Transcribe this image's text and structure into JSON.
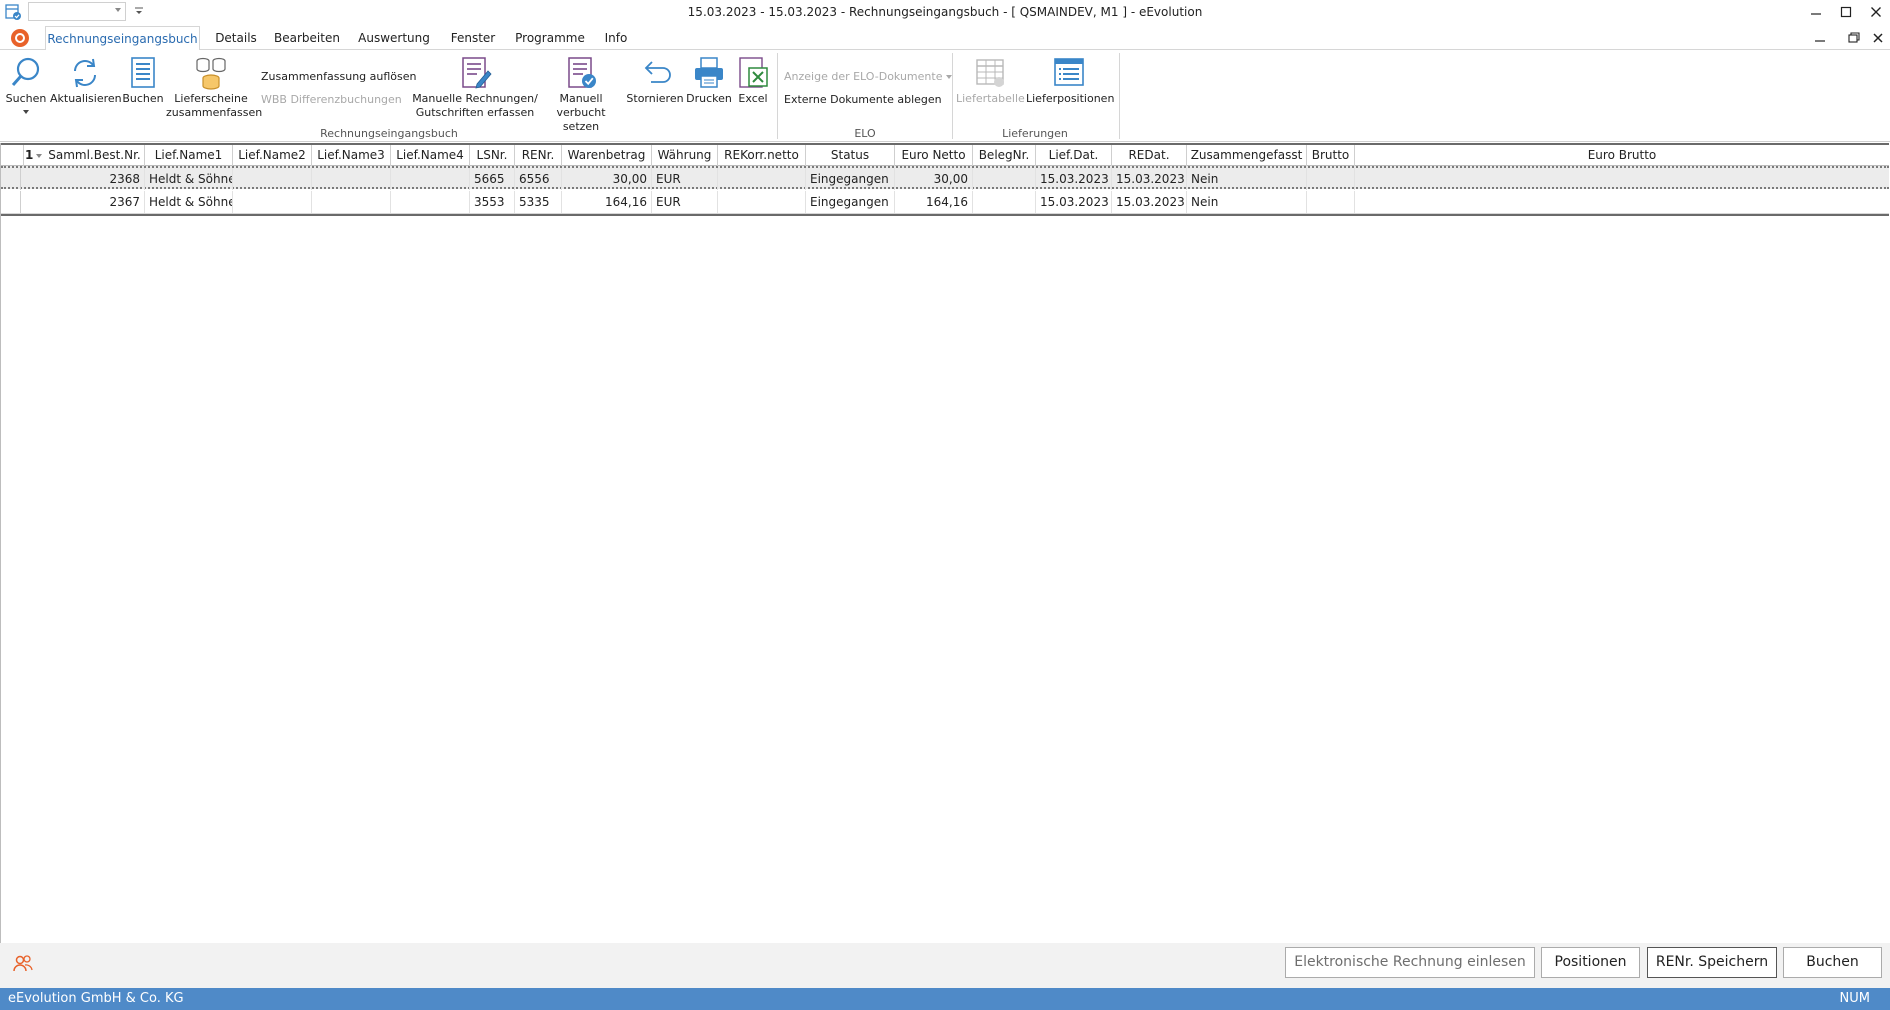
{
  "window": {
    "title": "15.03.2023 - 15.03.2023 - Rechnungseingangsbuch - [ QSMAINDEV, M1 ]  -  eEvolution"
  },
  "tabs": [
    {
      "label": "Rechnungseingangsbuch",
      "active": true
    },
    {
      "label": "Details"
    },
    {
      "label": "Bearbeiten"
    },
    {
      "label": "Auswertung"
    },
    {
      "label": "Fenster"
    },
    {
      "label": "Programme"
    },
    {
      "label": "Info"
    }
  ],
  "ribbon": {
    "rechnungseingangsbuch": {
      "label": "Rechnungseingangsbuch",
      "suchen": "Suchen",
      "aktualisieren": "Aktualisieren",
      "buchen": "Buchen",
      "lieferscheine_1": "Lieferscheine",
      "lieferscheine_2": "zusammenfassen",
      "zusammenfassung_aufloesen": "Zusammenfassung  auflösen",
      "wbb_differenzbuchungen": "WBB Differenzbuchungen",
      "manuelle_1": "Manuelle Rechnungen/",
      "manuelle_2": "Gutschriften erfassen",
      "manuell_1": "Manuell",
      "manuell_2": "verbucht setzen",
      "stornieren": "Stornieren",
      "drucken": "Drucken",
      "excel": "Excel"
    },
    "elo": {
      "label": "ELO",
      "anzeige": "Anzeige der ELO-Dokumente",
      "externe": "Externe Dokumente ablegen"
    },
    "lieferungen": {
      "label": "Lieferungen",
      "liefertabelle": "Liefertabelle",
      "lieferpositionen": "Lieferpositionen"
    }
  },
  "grid": {
    "sort_indicator": "1",
    "columns": [
      "Samml.Best.Nr.",
      "Lief.Name1",
      "Lief.Name2",
      "Lief.Name3",
      "Lief.Name4",
      "LSNr.",
      "RENr.",
      "Warenbetrag",
      "Währung",
      "REKorr.netto",
      "Status",
      "Euro Netto",
      "BelegNr.",
      "Lief.Dat.",
      "REDat.",
      "Zusammengefasst",
      "Brutto",
      "Euro Brutto"
    ],
    "rows": [
      {
        "samml": "2368",
        "name1": "Heldt & Söhne",
        "name2": "",
        "name3": "",
        "name4": "",
        "lsnr": "5665",
        "renr": "6556",
        "warenbetrag": "30,00",
        "waehrung": "EUR",
        "rekorr": "",
        "status": "Eingegangen",
        "euro_netto": "30,00",
        "belegnr": "",
        "liefdat": "15.03.2023",
        "redat": "15.03.2023",
        "zusammengefasst": "Nein",
        "brutto": "",
        "euro_brutto": ""
      },
      {
        "samml": "2367",
        "name1": "Heldt & Söhne",
        "name2": "",
        "name3": "",
        "name4": "",
        "lsnr": "3553",
        "renr": "5335",
        "warenbetrag": "164,16",
        "waehrung": "EUR",
        "rekorr": "",
        "status": "Eingegangen",
        "euro_netto": "164,16",
        "belegnr": "",
        "liefdat": "15.03.2023",
        "redat": "15.03.2023",
        "zusammengefasst": "Nein",
        "brutto": "",
        "euro_brutto": ""
      }
    ]
  },
  "footer": {
    "elektronische": "Elektronische Rechnung einlesen",
    "positionen": "Positionen",
    "renr_speichern": "RENr. Speichern",
    "buchen": "Buchen"
  },
  "status": {
    "company": "eEvolution GmbH & Co. KG",
    "num": "NUM"
  },
  "colors": {
    "accent": "#2a6bb0",
    "status_bar": "#4f8ac8",
    "icon_blue": "#3a86c8",
    "logo": "#e8622a"
  }
}
